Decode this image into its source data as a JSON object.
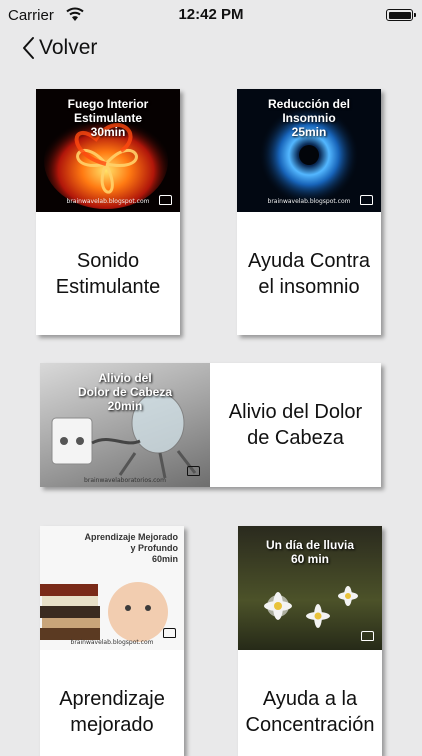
{
  "status_bar": {
    "carrier": "Carrier",
    "time": "12:42 PM"
  },
  "nav": {
    "back_label": "Volver"
  },
  "cards": [
    {
      "label": "Sonido\nEstimulante",
      "cover_title": "Fuego Interior\nEstimulante\n30min",
      "cover_url": "brainwavelab.blogspot.com"
    },
    {
      "label": "Ayuda Contra\nel insomnio",
      "cover_title": "Reducción del\nInsomnio\n25min",
      "cover_url": "brainwavelab.blogspot.com"
    },
    {
      "label": "Alivio del Dolor\nde Cabeza",
      "cover_title": "Alivio del\nDolor de Cabeza\n20min",
      "cover_url": "brainwavelaboratorios.com"
    },
    {
      "label": "Aprendizaje\nmejorado",
      "cover_title": "Aprendizaje Mejorado\ny Profundo\n60min",
      "cover_url": "brainwavelab.blogspot.com"
    },
    {
      "label": "Ayuda a la\nConcentración",
      "cover_title": "Un día de lluvia\n60 min",
      "cover_url": ""
    }
  ]
}
